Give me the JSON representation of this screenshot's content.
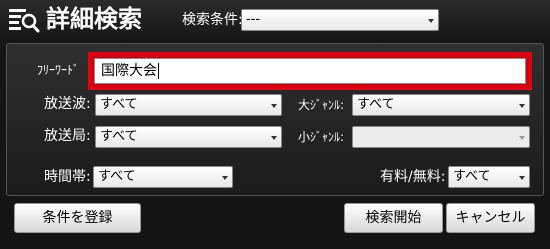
{
  "header": {
    "title": "詳細検索",
    "search_condition_label": "検索条件:",
    "search_condition_value": "---"
  },
  "form": {
    "free_word_label": "ﾌﾘｰﾜｰﾄﾞ",
    "free_word_value": "国際大会",
    "broadcast_wave_label": "放送波:",
    "broadcast_wave_value": "すべて",
    "broadcast_station_label": "放送局:",
    "broadcast_station_value": "すべて",
    "major_genre_label": "大ｼﾞｬﾝﾙ:",
    "major_genre_value": "すべて",
    "minor_genre_label": "小ｼﾞｬﾝﾙ:",
    "minor_genre_value": "",
    "time_slot_label": "時間帯:",
    "time_slot_value": "すべて",
    "paid_free_label": "有料/無料:",
    "paid_free_value": "すべて"
  },
  "footer": {
    "register_button": "条件を登録",
    "start_search_button": "検索開始",
    "cancel_button": "キャンセル"
  },
  "colors": {
    "highlight": "#e00012",
    "background": "#151515"
  }
}
